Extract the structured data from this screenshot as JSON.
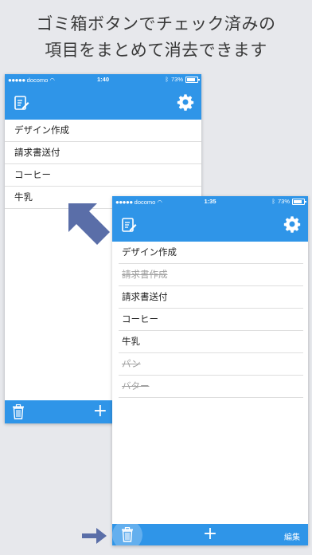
{
  "headline": {
    "line1": "ゴミ箱ボタンでチェック済みの",
    "line2": "項目をまとめて消去できます"
  },
  "colors": {
    "accent": "#2f95e8",
    "done_text": "#a0a0a0",
    "arrow": "#5a6ea8"
  },
  "back_screen": {
    "status": {
      "carrier": "docomo",
      "time": "1:40",
      "battery": "73%"
    },
    "items": [
      {
        "label": "デザイン作成",
        "done": false
      },
      {
        "label": "請求書送付",
        "done": false
      },
      {
        "label": "コーヒー",
        "done": false
      },
      {
        "label": "牛乳",
        "done": false
      }
    ],
    "toolbar": {
      "add": "+",
      "icons": [
        "trash-icon"
      ]
    }
  },
  "front_screen": {
    "status": {
      "carrier": "docomo",
      "time": "1:35",
      "battery": "73%"
    },
    "items": [
      {
        "label": "デザイン作成",
        "done": false
      },
      {
        "label": "請求書作成",
        "done": true
      },
      {
        "label": "請求書送付",
        "done": false
      },
      {
        "label": "コーヒー",
        "done": false
      },
      {
        "label": "牛乳",
        "done": false
      },
      {
        "label": "パン",
        "done": true
      },
      {
        "label": "バター",
        "done": true
      }
    ],
    "toolbar": {
      "add": "+",
      "edit": "編集",
      "icons": [
        "trash-icon"
      ]
    }
  },
  "nav_icons": {
    "left": "notepad-edit-icon",
    "right": "gear-icon"
  }
}
